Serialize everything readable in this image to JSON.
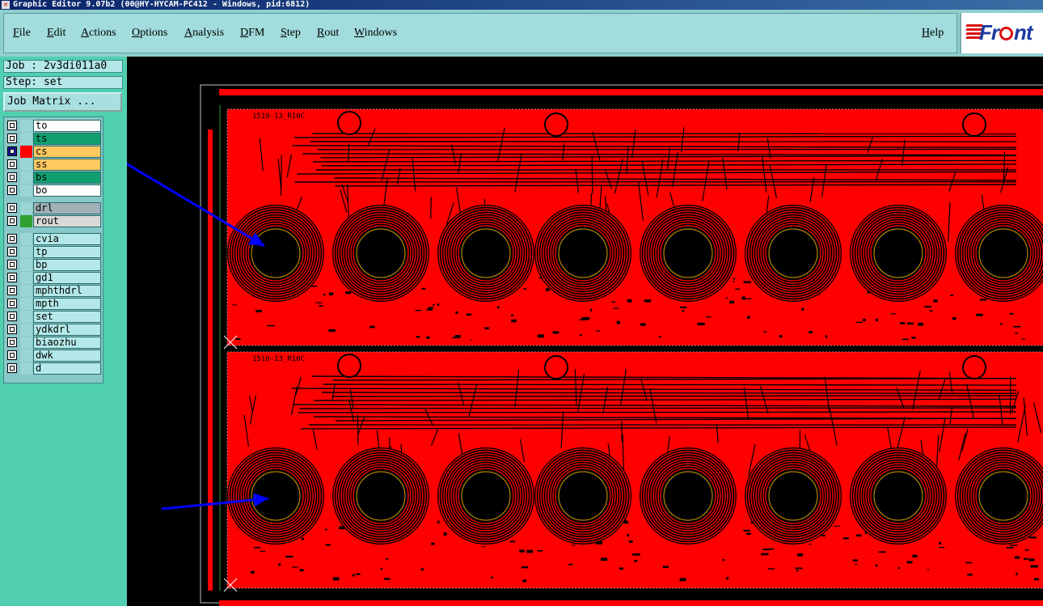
{
  "window": {
    "title": "Graphic Editor 9.07b2 (00@HY-HYCAM-PC412 - Windows, pid:6812)",
    "close_glyph": "✕"
  },
  "menu": {
    "items": [
      "File",
      "Edit",
      "Actions",
      "Options",
      "Analysis",
      "DFM",
      "Step",
      "Rout",
      "Windows"
    ],
    "help": "Help"
  },
  "logo": {
    "text_before_o": "Fr",
    "text_after_o": "nt",
    "icon": "frontline-logo"
  },
  "job": {
    "label": "Job : 2v3di011a0"
  },
  "step": {
    "label": "Step: set"
  },
  "job_matrix_button": "Job Matrix ...",
  "layers": [
    {
      "name": "to",
      "bg": "#ffffff",
      "color": "#9ad4d4",
      "active": false
    },
    {
      "name": "ts",
      "bg": "#10a070",
      "color": "#9ad4d4",
      "active": false
    },
    {
      "name": "cs",
      "bg": "#ffc860",
      "color": "#ff0000",
      "active": true
    },
    {
      "name": "ss",
      "bg": "#ffc860",
      "color": "#9ad4d4",
      "active": false
    },
    {
      "name": "bs",
      "bg": "#10a070",
      "color": "#9ad4d4",
      "active": false
    },
    {
      "name": "bo",
      "bg": "#ffffff",
      "color": "#9ad4d4",
      "active": false
    },
    {
      "name": "drl",
      "bg": "#a0b0b8",
      "color": "#9ad4d4",
      "active": false
    },
    {
      "name": "rout",
      "bg": "#d8d8d8",
      "color": "#30a030",
      "active": false
    },
    {
      "name": "cvia",
      "bg": "#b4e8e8",
      "color": "#9ad4d4",
      "active": false
    },
    {
      "name": "tp",
      "bg": "#b4e8e8",
      "color": "#9ad4d4",
      "active": false
    },
    {
      "name": "bp",
      "bg": "#b4e8e8",
      "color": "#9ad4d4",
      "active": false
    },
    {
      "name": "gd1",
      "bg": "#b4e8e8",
      "color": "#9ad4d4",
      "active": false
    },
    {
      "name": "mphthdrl",
      "bg": "#b4e8e8",
      "color": "#9ad4d4",
      "active": false
    },
    {
      "name": "mpth",
      "bg": "#b4e8e8",
      "color": "#9ad4d4",
      "active": false
    },
    {
      "name": "set",
      "bg": "#b4e8e8",
      "color": "#9ad4d4",
      "active": false
    },
    {
      "name": "ydkdrl",
      "bg": "#b4e8e8",
      "color": "#9ad4d4",
      "active": false
    },
    {
      "name": "biaozhu",
      "bg": "#b4e8e8",
      "color": "#9ad4d4",
      "active": false
    },
    {
      "name": "dwk",
      "bg": "#b4e8e8",
      "color": "#9ad4d4",
      "active": false
    },
    {
      "name": "d",
      "bg": "#b4e8e8",
      "color": "#9ad4d4",
      "active": false
    }
  ],
  "board": {
    "panel_labels": [
      "1510-13_R10C",
      "1510-13_R10C"
    ],
    "copper_color": "#ff0000",
    "ring_count_per_row": 8
  },
  "annotations": {
    "arrow_color": "#0000ff"
  }
}
